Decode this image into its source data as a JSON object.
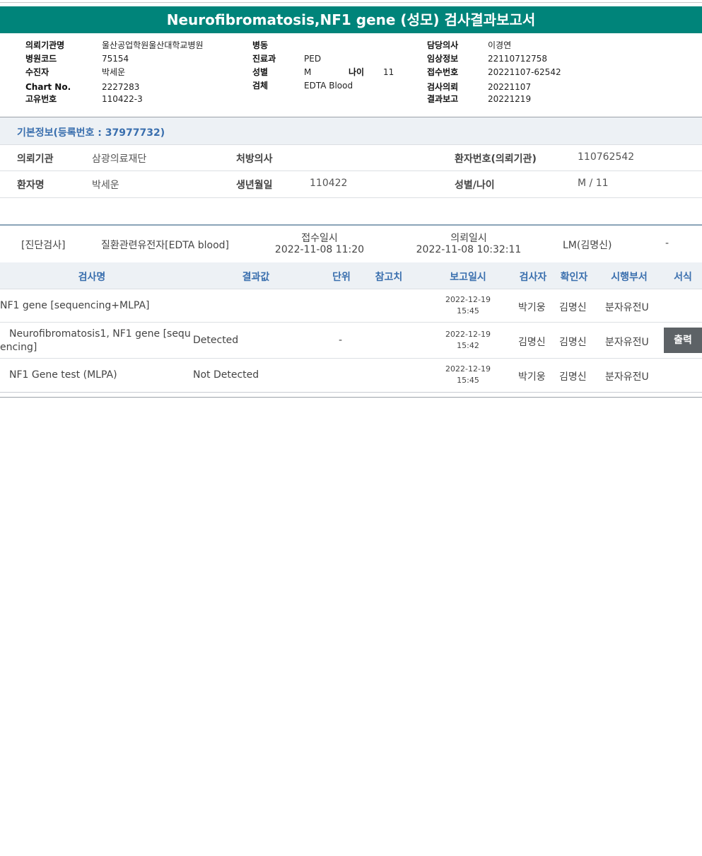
{
  "report": {
    "title": "Neurofibromatosis,NF1 gene (성모) 검사결과보고서",
    "header": {
      "institution_label": "의뢰기관명",
      "institution_value": "울산공업학원울산대학교병원",
      "hospital_code_label": "병원코드",
      "hospital_code_value": "75154",
      "patient_label": "수진자",
      "patient_value": "박세운",
      "chart_no_label": "Chart No.",
      "chart_no_value": "2227283",
      "unique_no_label": "고유번호",
      "unique_no_value": "110422-3",
      "ward_label": "병동",
      "ward_value": "",
      "dept_label": "진료과",
      "dept_value": "PED",
      "sex_label": "성별",
      "sex_value": "M",
      "age_label": "나이",
      "age_value": "11",
      "specimen_label": "검체",
      "specimen_value": "EDTA Blood",
      "doctor_label": "담당의사",
      "doctor_value": "이경연",
      "clinical_label": "임상정보",
      "clinical_value": "22110712758",
      "receipt_label": "접수번호",
      "receipt_value": "20221107-62542",
      "request_label": "검사의뢰",
      "request_value": "20221107",
      "result_label": "결과보고",
      "result_value": "20221219"
    }
  },
  "basic": {
    "title": "기본정보(등록번호 : 37977732)",
    "inst_label": "의뢰기관",
    "inst_value": "삼광의료재단",
    "prescriber_label": "처방의사",
    "prescriber_value": "",
    "patno_label": "환자번호(의뢰기관)",
    "patno_value": "110762542",
    "name_label": "환자명",
    "name_value": "박세운",
    "birth_label": "생년월일",
    "birth_value": "110422",
    "sexage_label": "성별/나이",
    "sexage_value": "M / 11"
  },
  "order": {
    "category": "[진단검사]",
    "name": "질환관련유전자[EDTA blood]",
    "receipt_label": "접수일시",
    "receipt_value": "2022-11-08  11:20",
    "request_label": "의뢰일시",
    "request_value": "2022-11-08  10:32:11",
    "lab": "LM(김명신)",
    "dash": "-"
  },
  "table": {
    "headers": {
      "name": "검사명",
      "result": "결과값",
      "unit": "단위",
      "ref": "참고치",
      "date": "보고일시",
      "tester": "검사자",
      "confirmer": "확인자",
      "dept": "시행부서",
      "format": "서식"
    },
    "rows": [
      {
        "name": "NF1 gene [sequencing+MLPA]",
        "result": "",
        "unit": "",
        "date": "2022-12-19",
        "time": "15:45",
        "tester": "박기웅",
        "confirmer": "김명신",
        "dept": "분자유전U"
      },
      {
        "name_line1": "Neurofibromatosis1, NF1 gene [sequ",
        "name_line2": "encing]",
        "result": "Detected",
        "unit": "-",
        "date": "2022-12-19",
        "time": "15:42",
        "tester": "김명신",
        "confirmer": "김명신",
        "dept": "분자유전U",
        "print_label": "출력"
      },
      {
        "name": "NF1 Gene test (MLPA)",
        "result": "Not Detected",
        "unit": "",
        "date": "2022-12-19",
        "time": "15:45",
        "tester": "박기웅",
        "confirmer": "김명신",
        "dept": "분자유전U"
      }
    ]
  }
}
